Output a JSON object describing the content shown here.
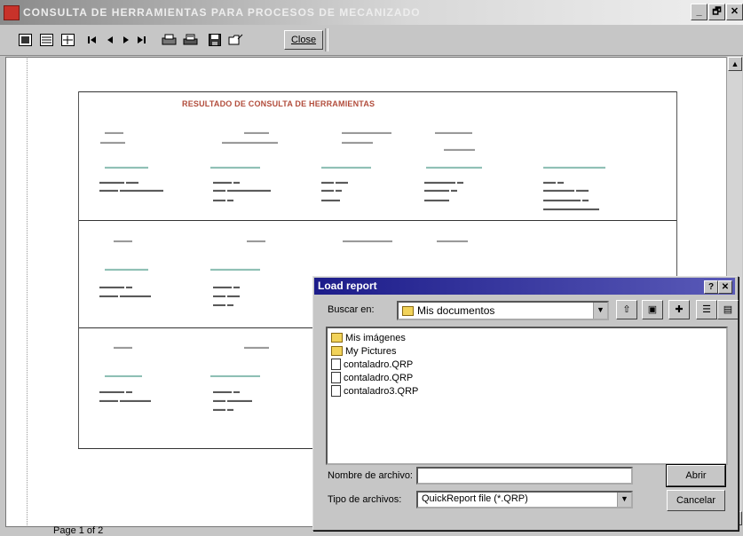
{
  "window": {
    "title": "CONSULTA DE HERRAMIENTAS PARA PROCESOS DE MECANIZADO",
    "controls": [
      "_",
      "🗗",
      "✕"
    ]
  },
  "toolbar": {
    "close_label": "Close",
    "icons": [
      "zoom-fit-icon",
      "zoom-100-icon",
      "zoom-width-icon",
      "first-page-icon",
      "prev-page-icon",
      "next-page-icon",
      "last-page-icon",
      "print-setup-icon",
      "print-icon",
      "save-icon",
      "open-icon"
    ]
  },
  "report": {
    "title": "RESULTADO DE CONSULTA DE HERRAMIENTAS"
  },
  "status": {
    "page_text": "Page 1 of 2"
  },
  "dialog": {
    "title": "Load report",
    "help": "?",
    "close": "✕",
    "look_in_label": "Buscar en:",
    "look_in_value": "Mis documentos",
    "files": [
      {
        "name": "Mis imágenes",
        "kind": "folder"
      },
      {
        "name": "My Pictures",
        "kind": "folder"
      },
      {
        "name": "contaladro.QRP",
        "kind": "file"
      },
      {
        "name": "contaladro.QRP",
        "kind": "file"
      },
      {
        "name": "contaladro3.QRP",
        "kind": "file"
      }
    ],
    "filename_label": "Nombre de archivo:",
    "filename_value": "",
    "filetype_label": "Tipo de archivos:",
    "filetype_value": "QuickReport file (*.QRP)",
    "open_label": "Abrir",
    "cancel_label": "Cancelar"
  }
}
